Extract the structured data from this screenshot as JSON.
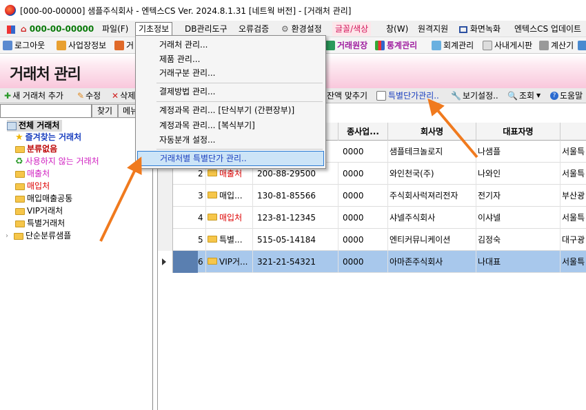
{
  "window": {
    "title": "[000-00-00000] 샘플주식회사 - 엔텍스CS Ver. 2024.8.1.31 [네트웍 버전] - [거래처 관리]"
  },
  "menubar": {
    "company_code": "000-00-00000",
    "items": [
      "파일(F)",
      "기초정보",
      "DB관리도구",
      "오류검증",
      "환경설정",
      "글꼴/색상",
      "창(W)",
      "원격지원",
      "화면녹화",
      "엔텍스CS 업데이트"
    ]
  },
  "toolbar1": {
    "items": [
      "로그아웃",
      "사업장정보",
      "거",
      "거래원장",
      "통계관리",
      "회계관리",
      "사내게시판",
      "계산기"
    ]
  },
  "page": {
    "title": "거래처 관리"
  },
  "toolbar2": {
    "items": [
      "새 거래처 추가",
      "수정",
      "삭제",
      "잔액 맞추기",
      "특별단가관리..",
      "보기설정..",
      "조회",
      "도움말"
    ]
  },
  "search": {
    "button": "찾기",
    "menu_button": "메뉴"
  },
  "tree": {
    "root": "전체 거래처",
    "nodes": [
      "즐겨찾는 거래처",
      "분류없음",
      "사용하지 않는 거래처",
      "매출처",
      "매입처",
      "매입매출공통",
      "VIP거래처",
      "특별거래처",
      "단순분류샘플"
    ]
  },
  "grid": {
    "headers": [
      "종사업...",
      "회사명",
      "대표자명"
    ],
    "rows": [
      {
        "no": "",
        "type": "",
        "bizno": "",
        "branch": "0000",
        "company": "샘플테크놀로지",
        "ceo": "나샘플",
        "addr": "서울특"
      },
      {
        "no": "2",
        "type": "매출처",
        "bizno": "200-88-29500",
        "branch": "0000",
        "company": "와인천국(주)",
        "ceo": "나와인",
        "addr": "서울특"
      },
      {
        "no": "3",
        "type": "매입...",
        "bizno": "130-81-85566",
        "branch": "0000",
        "company": "주식회사럭져리전자",
        "ceo": "전기자",
        "addr": "부산광"
      },
      {
        "no": "4",
        "type": "매입처",
        "bizno": "123-81-12345",
        "branch": "0000",
        "company": "샤넬주식회사",
        "ceo": "이샤넬",
        "addr": "서울특"
      },
      {
        "no": "5",
        "type": "특별...",
        "bizno": "515-05-14184",
        "branch": "0000",
        "company": "엔티커뮤니케이션",
        "ceo": "김정숙",
        "addr": "대구광"
      },
      {
        "no": "6",
        "type": "VIP거...",
        "bizno": "321-21-54321",
        "branch": "0000",
        "company": "아마존주식회사",
        "ceo": "나대표",
        "addr": "서울특"
      }
    ]
  },
  "dropdown": {
    "items": [
      "거래처 관리...",
      "제품 관리...",
      "거래구분 관리...",
      "결제방법 관리...",
      "계정과목 관리... [단식부기 (간편장부)]",
      "계정과목 관리... [복식부기]",
      "자동분개 설정...",
      "거래처별 특별단가 관리.."
    ]
  },
  "colors": {
    "accent": "#1a3fbf",
    "selection": "#a8c8ec",
    "arrow": "#f07a1e",
    "header_pink": "#f9c8dc"
  }
}
